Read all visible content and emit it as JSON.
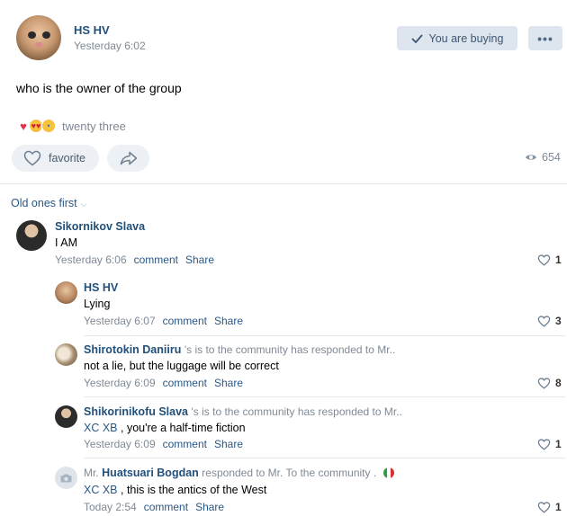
{
  "post": {
    "author": "HS HV",
    "time": "Yesterday 6:02",
    "buying_label": "You are buying",
    "more_label": "•••",
    "text": "who is the owner of the group",
    "reactions_count": "twenty three",
    "favorite_label": "favorite",
    "views": "654"
  },
  "sort": {
    "label": "Old ones first"
  },
  "comments": [
    {
      "author": "Sikornikov Slava",
      "text": "I AM",
      "time": "Yesterday 6:06",
      "comment_label": "comment",
      "share_label": "Share",
      "likes": "1"
    },
    {
      "author": "HS HV",
      "text": "Lying",
      "time": "Yesterday 6:07",
      "comment_label": "comment",
      "share_label": "Share",
      "likes": "3"
    },
    {
      "author": "Shirotokin Daniiru",
      "reply_note": "'s is to the community has responded to Mr..",
      "text": "not a lie, but the luggage will be correct",
      "time": "Yesterday 6:09",
      "comment_label": "comment",
      "share_label": "Share",
      "likes": "8"
    },
    {
      "author": "Shikorinikofu Slava",
      "reply_note": "'s is to the community has responded to Mr..",
      "mention": "XC XB",
      "text": ", you're a half-time fiction",
      "time": "Yesterday 6:09",
      "comment_label": "comment",
      "share_label": "Share",
      "likes": "1"
    },
    {
      "prefix": "Mr.",
      "author": "Huatsuari Bogdan",
      "reply_note": "responded to Mr. To the community .",
      "mention": "XC XB",
      "text": ", this is the antics of the West",
      "time": "Today 2:54",
      "comment_label": "comment",
      "share_label": "Share",
      "likes": "1"
    }
  ],
  "colors": {
    "link": "#2a5885",
    "name": "#22507a",
    "muted": "#7f8a96",
    "button_bg": "#dde5ee",
    "heart": "#e8304a"
  }
}
